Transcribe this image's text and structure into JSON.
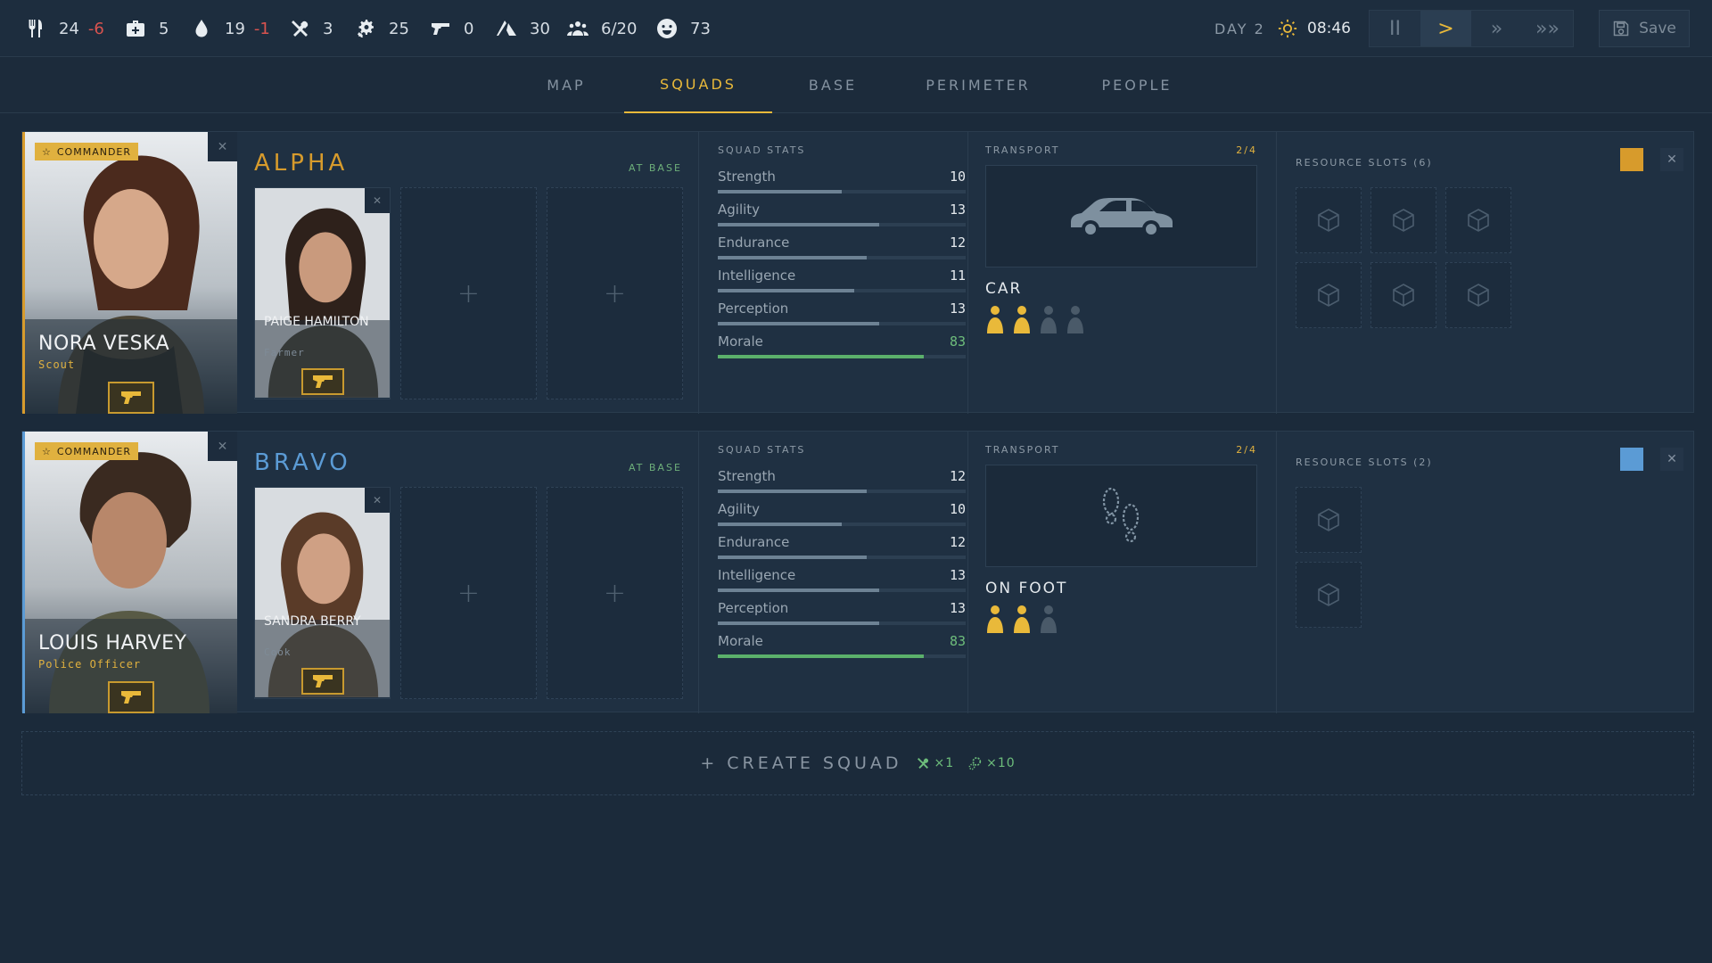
{
  "resources": [
    {
      "icon": "food-icon",
      "value": "24",
      "delta": "-6"
    },
    {
      "icon": "medkit-icon",
      "value": "5",
      "delta": ""
    },
    {
      "icon": "water-icon",
      "value": "19",
      "delta": "-1"
    },
    {
      "icon": "tools-icon",
      "value": "3",
      "delta": ""
    },
    {
      "icon": "parts-icon",
      "value": "25",
      "delta": ""
    },
    {
      "icon": "weapons-icon",
      "value": "0",
      "delta": ""
    },
    {
      "icon": "shelter-icon",
      "value": "30",
      "delta": ""
    },
    {
      "icon": "population-icon",
      "value": "6/20",
      "delta": ""
    },
    {
      "icon": "happiness-icon",
      "value": "73",
      "delta": ""
    }
  ],
  "clock": {
    "day": "DAY 2",
    "time": "08:46"
  },
  "speed": {
    "pause": "II",
    "play": ">",
    "fast": "»",
    "faster": "»»",
    "active": "play"
  },
  "save_label": "Save",
  "tabs": [
    {
      "label": "MAP"
    },
    {
      "label": "SQUADS",
      "active": true
    },
    {
      "label": "BASE"
    },
    {
      "label": "PERIMETER"
    },
    {
      "label": "PEOPLE"
    }
  ],
  "commander_badge": "COMMANDER",
  "squads": [
    {
      "name": "ALPHA",
      "status": "AT BASE",
      "color": "#d79b2c",
      "commander": {
        "name": "NORA VESKA",
        "role": "Scout"
      },
      "member": {
        "name": "PAIGE HAMILTON",
        "role": "Farmer"
      },
      "stats_header": "SQUAD STATS",
      "stats": [
        {
          "label": "Strength",
          "value": "10"
        },
        {
          "label": "Agility",
          "value": "13"
        },
        {
          "label": "Endurance",
          "value": "12"
        },
        {
          "label": "Intelligence",
          "value": "11"
        },
        {
          "label": "Perception",
          "value": "13"
        },
        {
          "label": "Morale",
          "value": "83"
        }
      ],
      "transport": {
        "header": "TRANSPORT",
        "count": "2/4",
        "name": "CAR",
        "icon": "car-icon",
        "seats_filled": 2,
        "seats_total": 4
      },
      "resource_header": "RESOURCE SLOTS (6)",
      "slots": 6
    },
    {
      "name": "BRAVO",
      "status": "AT BASE",
      "color": "#5b9bd5",
      "commander": {
        "name": "LOUIS HARVEY",
        "role": "Police Officer"
      },
      "member": {
        "name": "SANDRA BERRY",
        "role": "Cook"
      },
      "stats_header": "SQUAD STATS",
      "stats": [
        {
          "label": "Strength",
          "value": "12"
        },
        {
          "label": "Agility",
          "value": "10"
        },
        {
          "label": "Endurance",
          "value": "12"
        },
        {
          "label": "Intelligence",
          "value": "13"
        },
        {
          "label": "Perception",
          "value": "13"
        },
        {
          "label": "Morale",
          "value": "83"
        }
      ],
      "transport": {
        "header": "TRANSPORT",
        "count": "2/4",
        "name": "ON FOOT",
        "icon": "footprints-icon",
        "seats_filled": 2,
        "seats_total": 3
      },
      "resource_header": "RESOURCE SLOTS (2)",
      "slots": 2
    }
  ],
  "create_squad": {
    "label": "+ CREATE SQUAD",
    "cost_tools": "×1",
    "cost_parts": "×10"
  },
  "colors": {
    "accent": "#e9b93a",
    "bg": "#1b2a3a",
    "panel": "#1f3042",
    "positive": "#6dbd7b",
    "negative": "#d9534f"
  }
}
